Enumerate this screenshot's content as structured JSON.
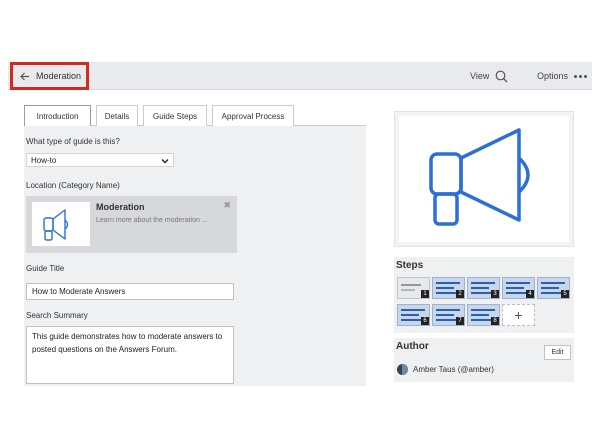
{
  "topbar": {
    "back_label": "Moderation",
    "view_label": "View",
    "options_label": "Options"
  },
  "tabs": [
    {
      "label": "Introduction",
      "active": true
    },
    {
      "label": "Details",
      "active": false
    },
    {
      "label": "Guide Steps",
      "active": false
    },
    {
      "label": "Approval Process",
      "active": false
    }
  ],
  "form": {
    "guide_type_label": "What type of guide is this?",
    "guide_type_value": "How-to",
    "location_label": "Location (Category Name)",
    "category": {
      "title": "Moderation",
      "description": "Learn more about the moderation ..."
    },
    "title_label": "Guide Title",
    "title_value": "How to Moderate Answers",
    "summary_label": "Search Summary",
    "summary_value": "This guide demonstrates how to moderate answers to posted questions on the Answers Forum."
  },
  "steps": {
    "title": "Steps",
    "items": [
      "1",
      "2",
      "3",
      "4",
      "5",
      "6",
      "7",
      "8"
    ],
    "add_label": "+"
  },
  "author": {
    "title": "Author",
    "edit_label": "Edit",
    "name": "Amber Taus (@amber)"
  },
  "colors": {
    "accent_blue": "#2d6fd8",
    "highlight_red": "#d22a1e"
  },
  "icons": {
    "back": "arrow-left-icon",
    "view": "search-icon",
    "options": "more-horizontal-icon",
    "dropdown": "chevron-down-icon",
    "close": "close-icon",
    "hero": "megaphone-icon"
  }
}
